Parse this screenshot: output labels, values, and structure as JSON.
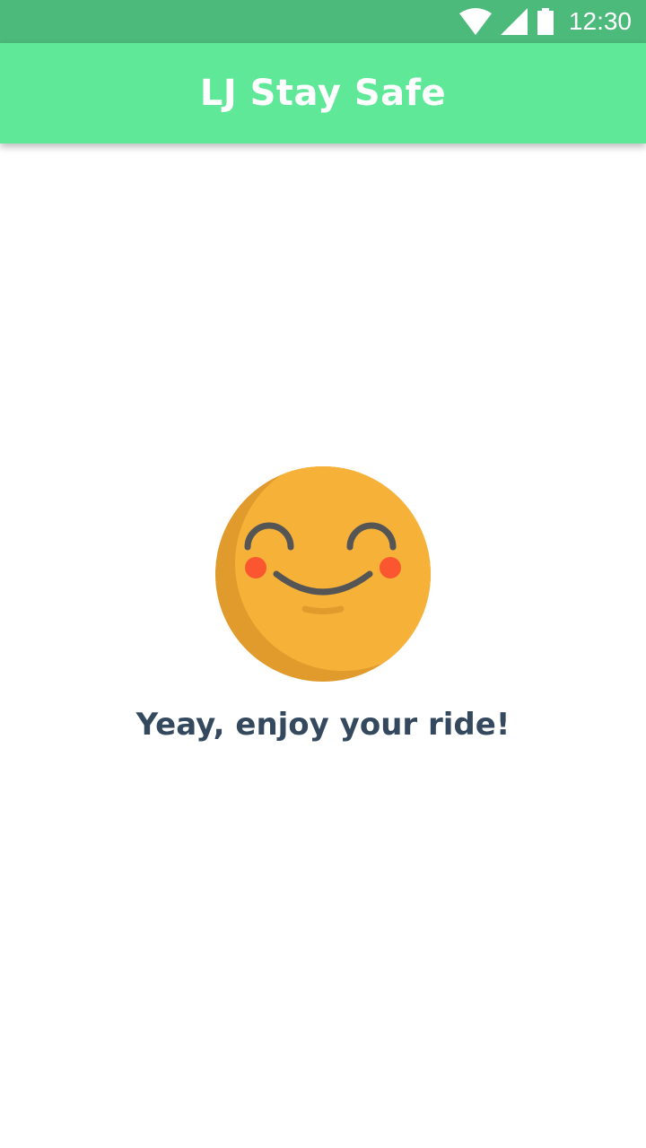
{
  "status_bar": {
    "time": "12:30",
    "icons": [
      "wifi-icon",
      "cellular-signal-icon",
      "battery-icon"
    ]
  },
  "app_bar": {
    "title": "LJ Stay Safe",
    "background_color": "#5fe898"
  },
  "main": {
    "illustration": "smiling-face-icon",
    "message": "Yeay, enjoy your ride!"
  },
  "colors": {
    "status_bar": "#4cba7a",
    "app_bar": "#5fe898",
    "emoji_face": "#f6b238",
    "emoji_shadow": "#e09b2c",
    "cheeks": "#fa5630",
    "text_dark": "#34495e"
  }
}
